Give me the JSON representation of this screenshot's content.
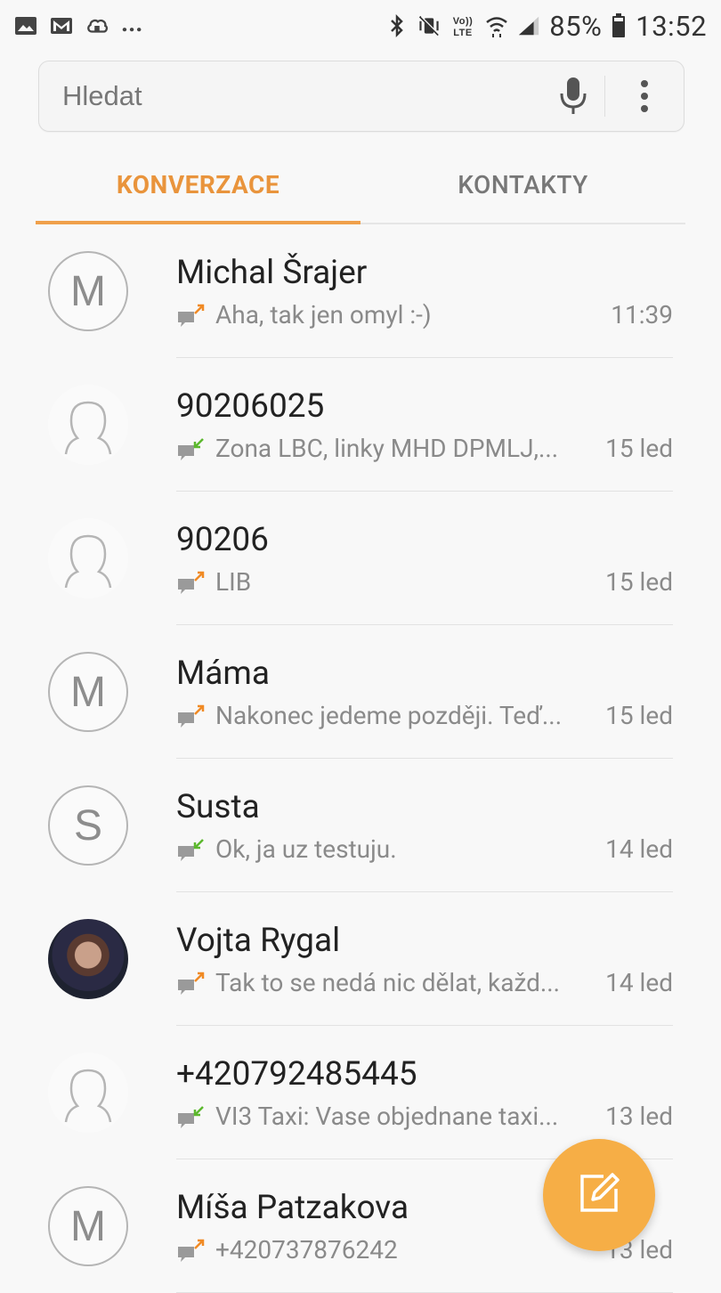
{
  "status_bar": {
    "battery": "85%",
    "time": "13:52",
    "notification_more": "...",
    "icons_left": [
      "image-icon",
      "gmail-icon",
      "cloud-sync-icon"
    ],
    "icons_right": [
      "bluetooth-icon",
      "vibrate-mute-icon",
      "volte-icon",
      "wifi-icon",
      "signal-icon",
      "battery-icon"
    ]
  },
  "search": {
    "placeholder": "Hledat"
  },
  "tabs": [
    {
      "label": "KONVERZACE",
      "active": true
    },
    {
      "label": "KONTAKTY",
      "active": false
    }
  ],
  "conversations": [
    {
      "initial": "M",
      "avatar": "letter",
      "name": "Michal Šrajer",
      "snippet": "Aha, tak jen omyl :-)",
      "direction": "outgoing",
      "time": "11:39"
    },
    {
      "initial": "",
      "avatar": "silhouette",
      "name": "90206025",
      "snippet": "Zona LBC, linky MHD DPMLJ,...",
      "direction": "incoming",
      "time": "15 led"
    },
    {
      "initial": "",
      "avatar": "silhouette",
      "name": "90206",
      "snippet": "LIB",
      "direction": "outgoing",
      "time": "15 led"
    },
    {
      "initial": "M",
      "avatar": "letter",
      "name": "Máma",
      "snippet": "Nakonec jedeme později.  Teď...",
      "direction": "outgoing",
      "time": "15 led"
    },
    {
      "initial": "S",
      "avatar": "letter",
      "name": "Susta",
      "snippet": "Ok, ja uz testuju.",
      "direction": "incoming",
      "time": "14 led"
    },
    {
      "initial": "",
      "avatar": "photo",
      "name": "Vojta Rygal",
      "snippet": "Tak to se nedá nic dělat, každ...",
      "direction": "outgoing",
      "time": "14 led"
    },
    {
      "initial": "",
      "avatar": "silhouette",
      "name": "+420792485445",
      "snippet": "VI3 Taxi: Vase objednane taxi...",
      "direction": "incoming",
      "time": "13 led"
    },
    {
      "initial": "M",
      "avatar": "letter",
      "name": "Míša Patzakova",
      "snippet": "+420737876242",
      "direction": "outgoing",
      "time": "13 led"
    }
  ],
  "colors": {
    "accent": "#f0a04b",
    "fab": "#f6ae46",
    "outgoing_arrow": "#f08a24",
    "incoming_arrow": "#5cb82d"
  },
  "fab": {
    "icon": "compose-icon"
  }
}
